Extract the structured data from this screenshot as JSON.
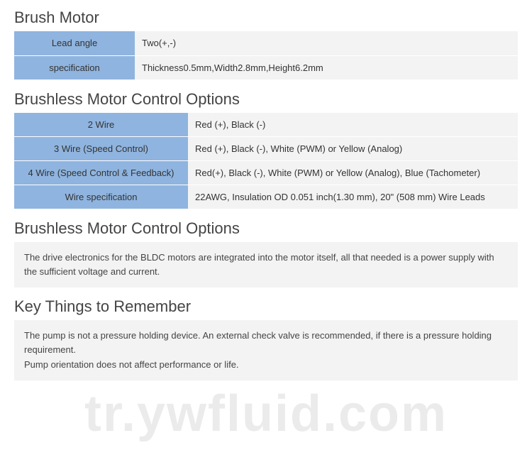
{
  "sections": {
    "brush_motor": {
      "title": "Brush Motor",
      "rows": [
        {
          "label": "Lead angle",
          "value": "Two(+,-)"
        },
        {
          "label": "specification",
          "value": "Thickness0.5mm,Width2.8mm,Height6.2mm"
        }
      ]
    },
    "brushless_options": {
      "title": "Brushless Motor Control Options",
      "rows": [
        {
          "label": "2 Wire",
          "value": "Red (+), Black (-)"
        },
        {
          "label": "3 Wire (Speed Control)",
          "value": "Red (+), Black (-), White (PWM) or Yellow (Analog)"
        },
        {
          "label": "4 Wire (Speed Control & Feedback)",
          "value": "Red(+), Black (-), White (PWM) or Yellow (Analog), Blue (Tachometer)"
        },
        {
          "label": "Wire specification",
          "value": "22AWG, Insulation OD 0.051 inch(1.30 mm), 20\" (508 mm) Wire Leads"
        }
      ]
    },
    "brushless_desc": {
      "title": "Brushless Motor Control Options",
      "text": "The drive electronics for the BLDC motors are integrated into the motor itself, all that needed is a power supply with the sufficient voltage and current."
    },
    "key_things": {
      "title": "Key Things to Remember",
      "line1": "The pump is not a pressure holding device. An external check valve is recommended, if there is a pressure holding requirement.",
      "line2": "Pump orientation does not affect performance or life."
    }
  },
  "watermark": "tr.ywfluid.com"
}
